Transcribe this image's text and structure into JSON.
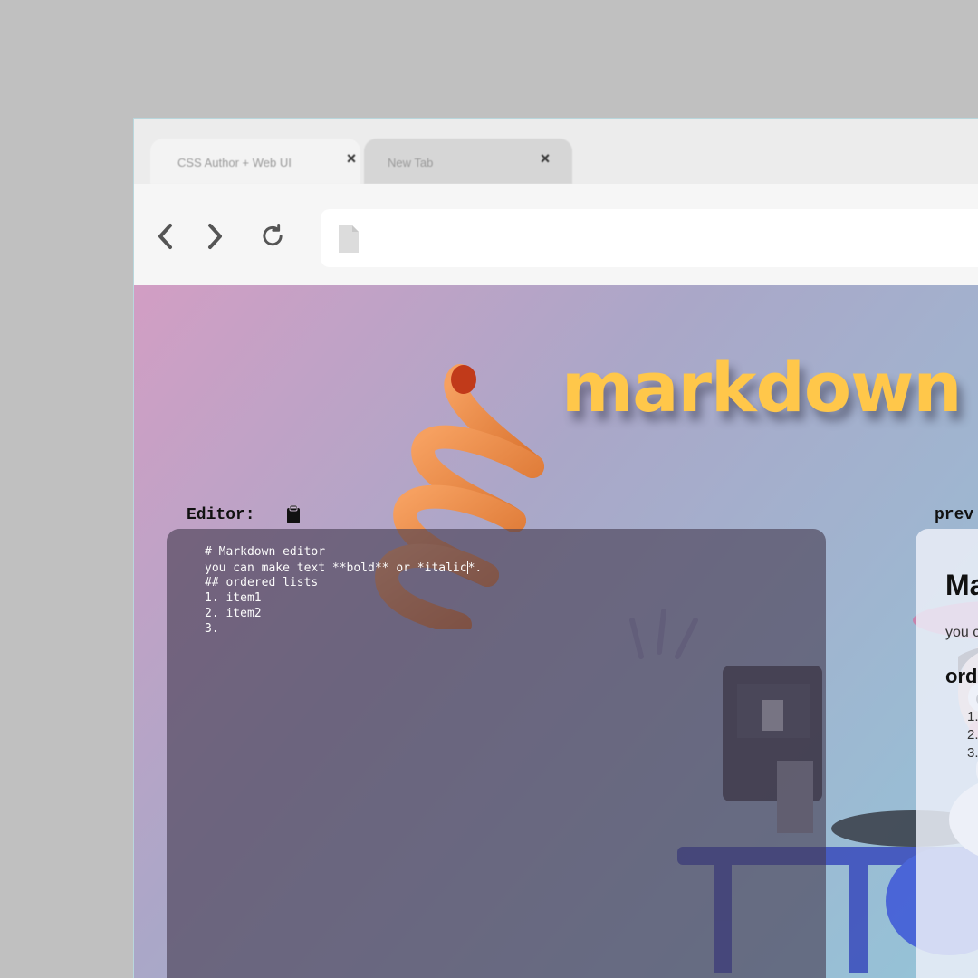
{
  "browser": {
    "tabs": [
      {
        "title": "CSS Author + Web UI",
        "close_icon": "×",
        "active": true
      },
      {
        "title": "New Tab",
        "close_icon": "×",
        "active": false
      }
    ],
    "nav_icons": [
      "back-arrow-icon",
      "forward-arrow-icon",
      "reload-icon",
      "page-icon"
    ],
    "address_value": ""
  },
  "page": {
    "title": "markdown e",
    "editor_label": "Editor:",
    "preview_label": "prev",
    "editor_lines": [
      "# Markdown editor",
      "you can make text **bold** or *italic*.",
      "## ordered lists",
      "1. item1",
      "2. item2",
      "3."
    ],
    "preview": {
      "h1": "Ma",
      "paragraph": "you c",
      "h2": "ord",
      "list": [
        "1.",
        "2.",
        "3."
      ]
    },
    "colors": {
      "title": "#ffc74a",
      "editor_bg": "#5c4f66",
      "background_start": "#d29ec4",
      "background_end": "#94c4d8"
    }
  }
}
